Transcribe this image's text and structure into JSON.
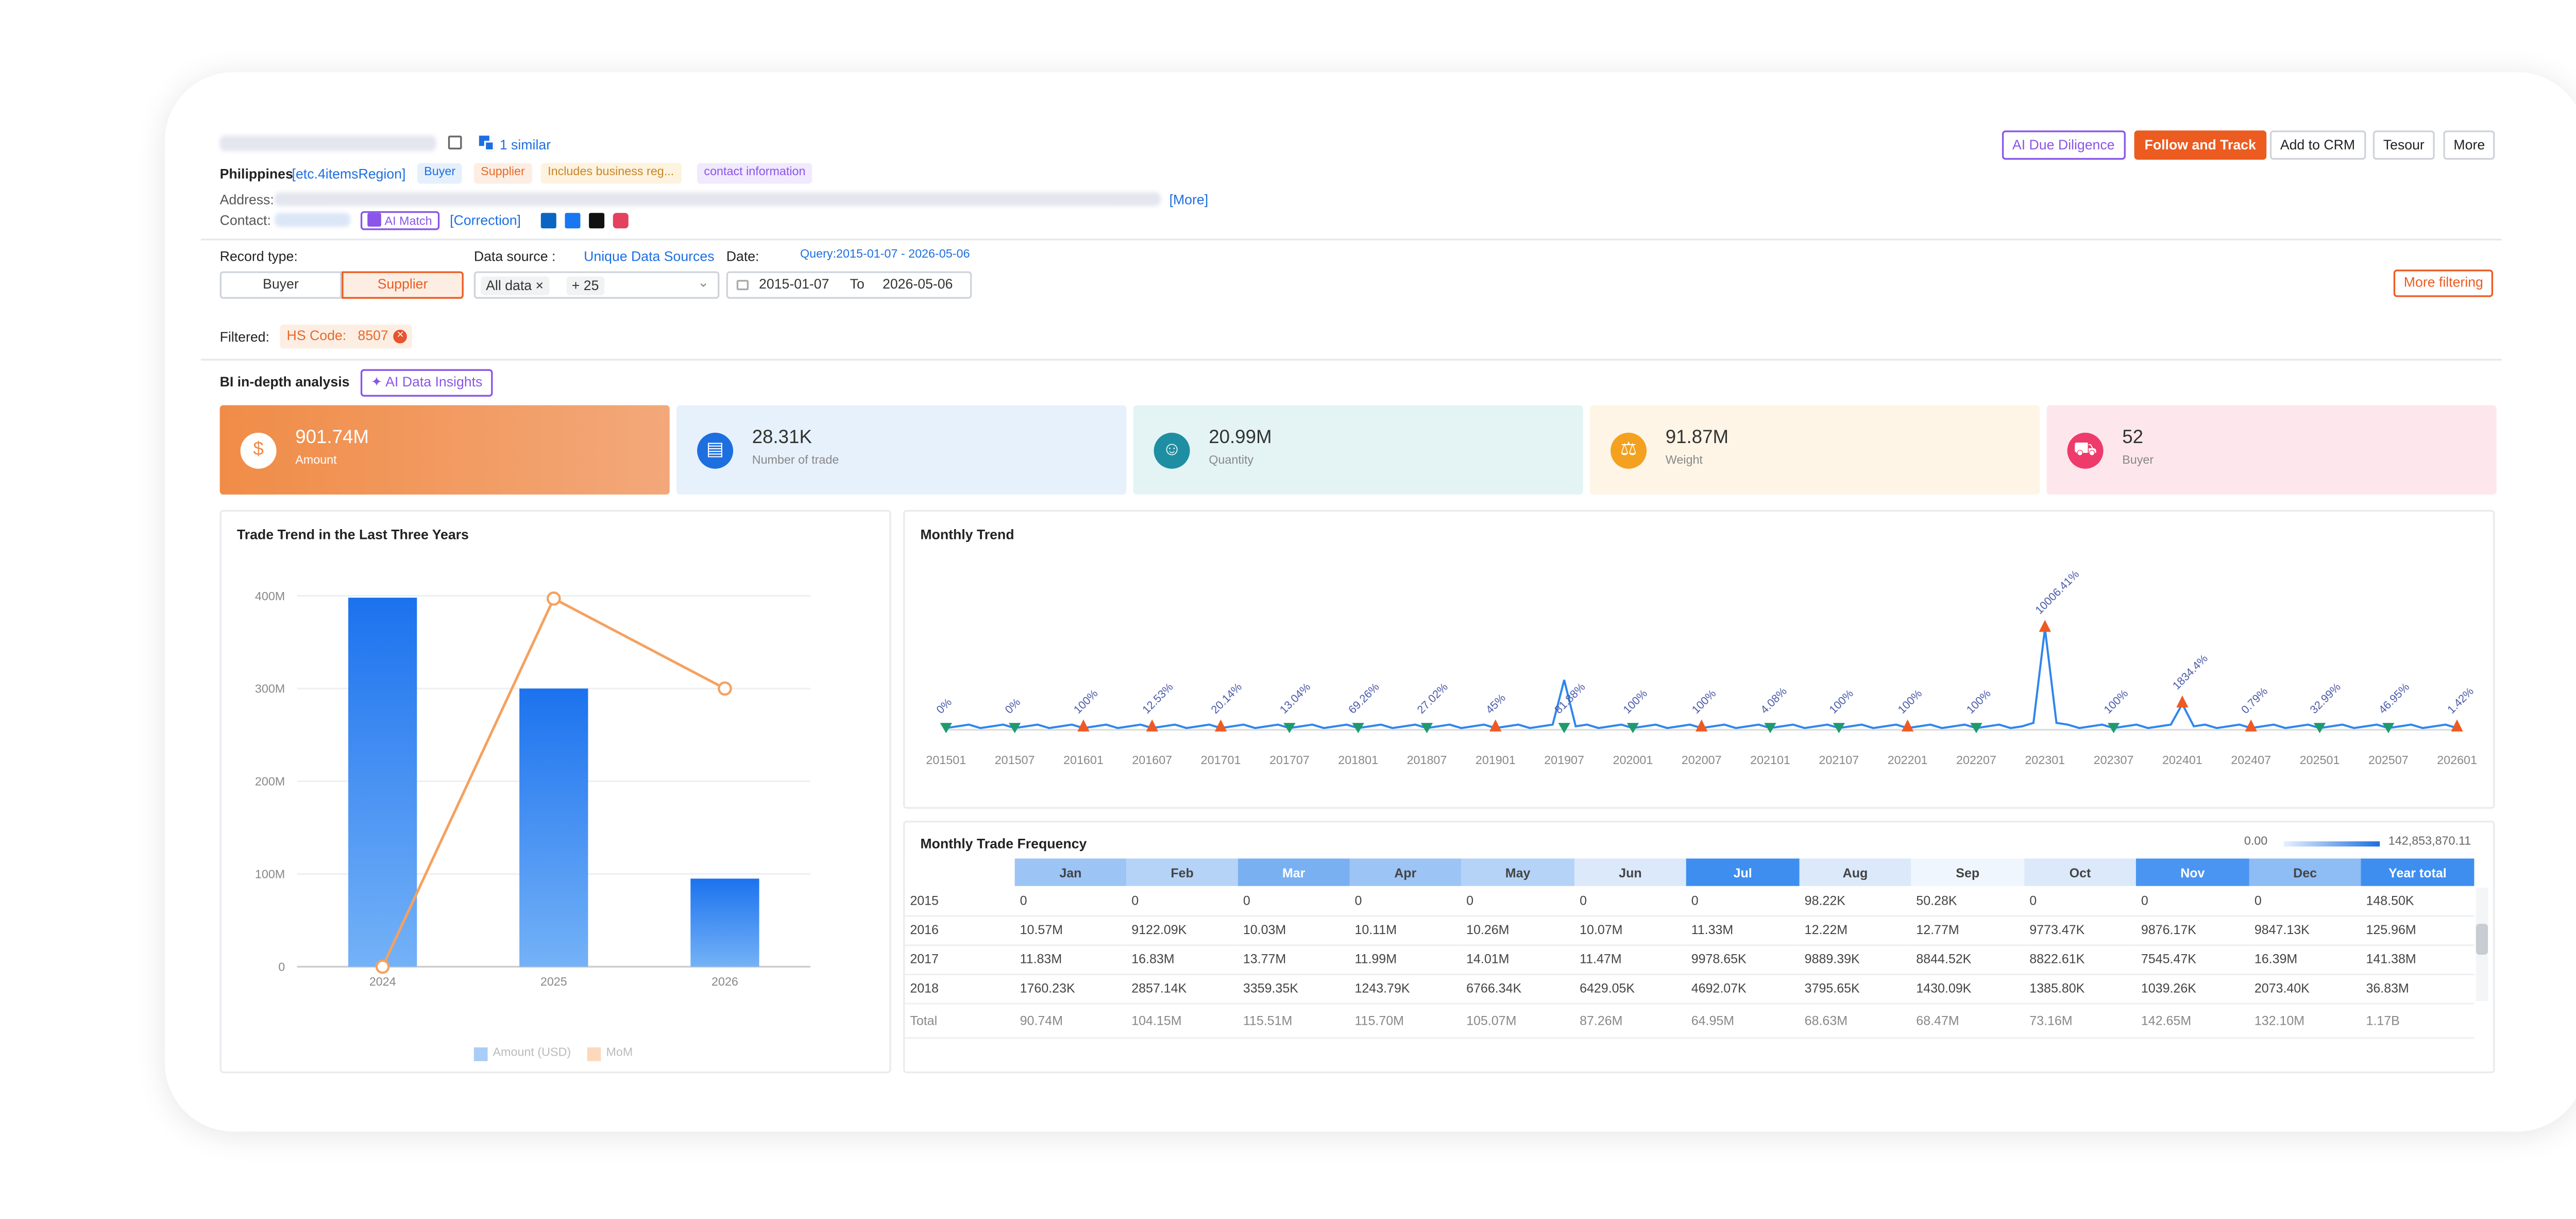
{
  "header": {
    "similar": "1 similar",
    "country": "Philippines",
    "region": "[etc.4itemsRegion]",
    "tags": [
      "Buyer",
      "Supplier",
      "Includes business reg...",
      "contact information"
    ],
    "address_label": "Address:",
    "more_link": "[More]",
    "contact_label": "Contact:",
    "ai_match": "AI Match",
    "correction": "[Correction]",
    "actions": [
      "AI Due Diligence",
      "Follow and Track",
      "Add to CRM",
      "Tesour",
      "More"
    ]
  },
  "filters": {
    "record_type_label": "Record type:",
    "record_types": [
      "Buyer",
      "Supplier"
    ],
    "data_source_label": "Data source :",
    "unique_link": "Unique Data Sources",
    "all_data": "All data",
    "plus": "+ 25",
    "date_label": "Date:",
    "query": "Query:2015-01-07 - 2026-05-06",
    "date_from": "2015-01-07",
    "to": "To",
    "date_to": "2026-05-06",
    "more_filtering": "More filtering",
    "filtered_label": "Filtered:",
    "filter_chip": "HS Code:   8507"
  },
  "bi": {
    "label": "BI in-depth analysis",
    "insights": "AI Data Insights"
  },
  "kpis": [
    {
      "value": "901.74M",
      "label": "Amount",
      "icon": "dollar-icon",
      "color": "#f08c47"
    },
    {
      "value": "28.31K",
      "label": "Number of trade",
      "icon": "calendar-icon",
      "color": "#1d6fe0"
    },
    {
      "value": "20.99M",
      "label": "Quantity",
      "icon": "user-icon",
      "color": "#1e8fa3"
    },
    {
      "value": "91.87M",
      "label": "Weight",
      "icon": "scale-icon",
      "color": "#f3a11e"
    },
    {
      "value": "52",
      "label": "Buyer",
      "icon": "cart-icon",
      "color": "#ee3b6b"
    }
  ],
  "trend_panel": {
    "title": "Trade Trend in the Last Three Years",
    "legend": [
      "Amount (USD)",
      "MoM"
    ]
  },
  "monthly_panel": {
    "title": "Monthly Trend"
  },
  "freq_panel": {
    "title": "Monthly Trade Frequency",
    "scale_min": "0.00",
    "scale_max": "142,853,870.11"
  },
  "chart_data": [
    {
      "type": "bar",
      "title": "Trade Trend in the Last Three Years",
      "categories": [
        "2024",
        "2025",
        "2026"
      ],
      "series": [
        {
          "name": "Amount (USD)",
          "values": [
            398000000,
            300000000,
            95000000
          ]
        },
        {
          "name": "MoM",
          "values": [
            1,
            397000000,
            300000000
          ]
        }
      ],
      "yticks": [
        "0",
        "100M",
        "200M",
        "300M",
        "400M"
      ],
      "ylim": [
        0,
        400000000
      ]
    },
    {
      "type": "line",
      "title": "Monthly Trend",
      "xticks": [
        "201501",
        "201507",
        "201601",
        "201607",
        "201701",
        "201707",
        "201801",
        "201807",
        "201901",
        "201907",
        "202001",
        "202007",
        "202101",
        "202107",
        "202201",
        "202207",
        "202301",
        "202307",
        "202401",
        "202407",
        "202501",
        "202507",
        "202601"
      ],
      "markers": [
        {
          "x": "201501",
          "label": "0%",
          "dir": "down"
        },
        {
          "x": "201507",
          "label": "0%",
          "dir": "down"
        },
        {
          "x": "201601",
          "label": "100%",
          "dir": "up"
        },
        {
          "x": "201607",
          "label": "12.53%",
          "dir": "up"
        },
        {
          "x": "201701",
          "label": "20.14%",
          "dir": "up"
        },
        {
          "x": "201707",
          "label": "13.04%",
          "dir": "down"
        },
        {
          "x": "201801",
          "label": "69.26%",
          "dir": "down"
        },
        {
          "x": "201807",
          "label": "27.02%",
          "dir": "down"
        },
        {
          "x": "201901",
          "label": "45%",
          "dir": "up"
        },
        {
          "x": "201907",
          "label": "81.88%",
          "dir": "down"
        },
        {
          "x": "202001",
          "label": "100%",
          "dir": "down"
        },
        {
          "x": "202007",
          "label": "100%",
          "dir": "up"
        },
        {
          "x": "202101",
          "label": "4.08%",
          "dir": "down"
        },
        {
          "x": "202107",
          "label": "100%",
          "dir": "down"
        },
        {
          "x": "202201",
          "label": "100%",
          "dir": "up"
        },
        {
          "x": "202207",
          "label": "100%",
          "dir": "down"
        },
        {
          "x": "202301",
          "label": "10006.41%",
          "dir": "up"
        },
        {
          "x": "202307",
          "label": "100%",
          "dir": "down"
        },
        {
          "x": "202401",
          "label": "1834.4%",
          "dir": "up"
        },
        {
          "x": "202407",
          "label": "0.79%",
          "dir": "up"
        },
        {
          "x": "202501",
          "label": "32.99%",
          "dir": "down"
        },
        {
          "x": "202507",
          "label": "46.95%",
          "dir": "down"
        },
        {
          "x": "202601",
          "label": "1.42%",
          "dir": "up"
        }
      ]
    },
    {
      "type": "table",
      "title": "Monthly Trade Frequency",
      "columns": [
        "",
        "Jan",
        "Feb",
        "Mar",
        "Apr",
        "May",
        "Jun",
        "Jul",
        "Aug",
        "Sep",
        "Oct",
        "Nov",
        "Dec",
        "Year total"
      ],
      "header_colors": [
        "#fff",
        "#9cc4f5",
        "#b5d3f7",
        "#79b0f1",
        "#9cc4f5",
        "#b5d3f7",
        "#dbe9fb",
        "#3e8ef0",
        "#dbe9fb",
        "#f0f6fe",
        "#dbe9fb",
        "#4a95f1",
        "#8ebcf4",
        "#3e8ef0"
      ],
      "rows": [
        [
          "2015",
          "0",
          "0",
          "0",
          "0",
          "0",
          "0",
          "0",
          "98.22K",
          "50.28K",
          "0",
          "0",
          "0",
          "148.50K"
        ],
        [
          "2016",
          "10.57M",
          "9122.09K",
          "10.03M",
          "10.11M",
          "10.26M",
          "10.07M",
          "11.33M",
          "12.22M",
          "12.77M",
          "9773.47K",
          "9876.17K",
          "9847.13K",
          "125.96M"
        ],
        [
          "2017",
          "11.83M",
          "16.83M",
          "13.77M",
          "11.99M",
          "14.01M",
          "11.47M",
          "9978.65K",
          "9889.39K",
          "8844.52K",
          "8822.61K",
          "7545.47K",
          "16.39M",
          "141.38M"
        ],
        [
          "2018",
          "1760.23K",
          "2857.14K",
          "3359.35K",
          "1243.79K",
          "6766.34K",
          "6429.05K",
          "4692.07K",
          "3795.65K",
          "1430.09K",
          "1385.80K",
          "1039.26K",
          "2073.40K",
          "36.83M"
        ]
      ],
      "total": [
        "Total",
        "90.74M",
        "104.15M",
        "115.51M",
        "115.70M",
        "105.07M",
        "87.26M",
        "64.95M",
        "68.63M",
        "68.47M",
        "73.16M",
        "142.65M",
        "132.10M",
        "1.17B"
      ]
    }
  ]
}
